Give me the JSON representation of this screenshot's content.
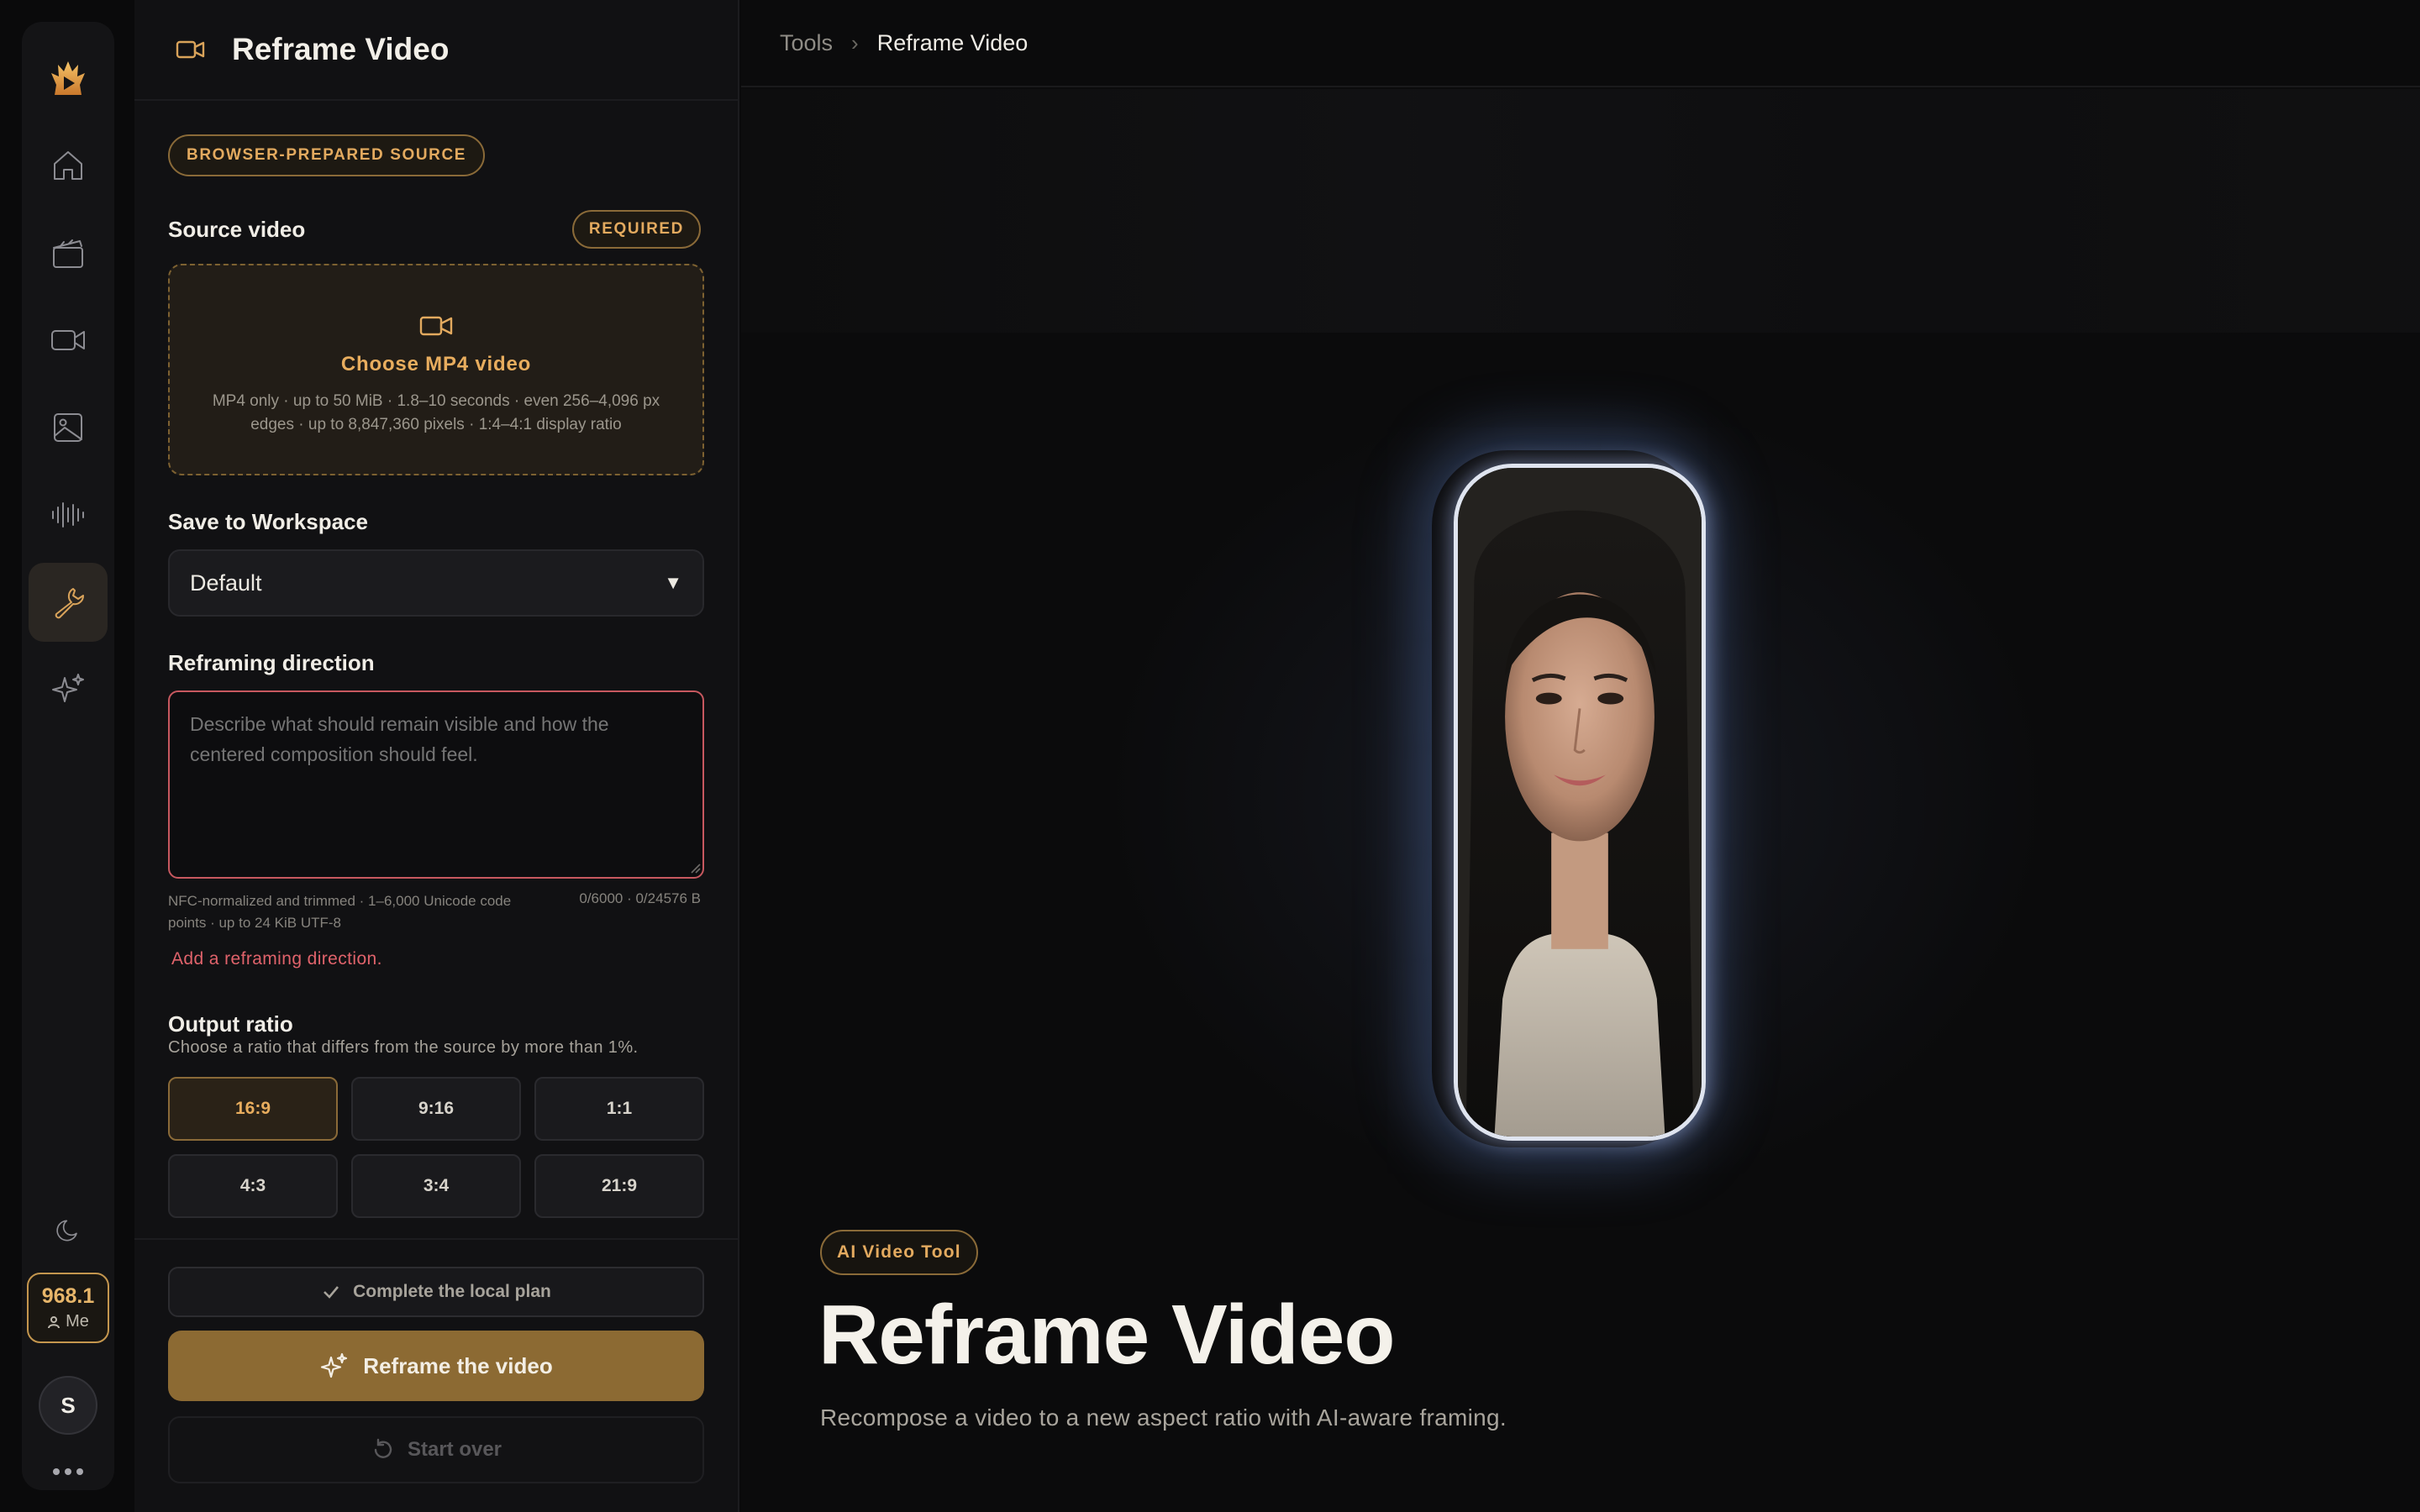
{
  "nav": {
    "items": [
      {
        "icon": "logo-icon"
      },
      {
        "icon": "home-icon"
      },
      {
        "icon": "clapperboard-icon"
      },
      {
        "icon": "video-camera-icon"
      },
      {
        "icon": "image-icon"
      },
      {
        "icon": "audio-waveform-icon"
      },
      {
        "icon": "wrench-icon",
        "active": true
      },
      {
        "icon": "sparkles-icon"
      }
    ],
    "theme_icon": "moon-icon",
    "credits": "968.1",
    "credits_owner": "Me",
    "avatar_initial": "S"
  },
  "panel": {
    "title": "Reframe Video",
    "source_badge": "BROWSER-PREPARED SOURCE",
    "source_label": "Source video",
    "required_badge": "REQUIRED",
    "dropzone": {
      "cta": "Choose MP4 video",
      "specs": "MP4 only · up to 50 MiB · 1.8–10 seconds · even 256–4,096 px edges · up to 8,847,360 pixels · 1:4–4:1 display ratio"
    },
    "workspace_label": "Save to Workspace",
    "workspace_value": "Default",
    "direction_label": "Reframing direction",
    "direction_placeholder": "Describe what should remain visible and how the centered composition should feel.",
    "direction_value": "",
    "direction_hint": "NFC-normalized and trimmed · 1–6,000 Unicode code points · up to 24 KiB UTF-8",
    "direction_counter": "0/6000 · 0/24576 B",
    "direction_error": "Add a reframing direction.",
    "ratio_label": "Output ratio",
    "ratio_note": "Choose a ratio that differs from the source by more than 1%.",
    "ratios": [
      "16:9",
      "9:16",
      "1:1",
      "4:3",
      "3:4",
      "21:9"
    ],
    "selected_ratio": "16:9",
    "plan_button": "Complete the local plan",
    "primary_button": "Reframe the video",
    "reset_button": "Start over"
  },
  "main": {
    "breadcrumb": [
      "Tools",
      "Reframe Video"
    ],
    "tag": "AI Video Tool",
    "title": "Reframe Video",
    "subtitle": "Recompose a video to a new aspect ratio with AI-aware framing."
  },
  "colors": {
    "accent": "#e3aa5f",
    "primary_button": "#8c6a33",
    "error": "#e0636b",
    "background": "#0b0b0c"
  }
}
